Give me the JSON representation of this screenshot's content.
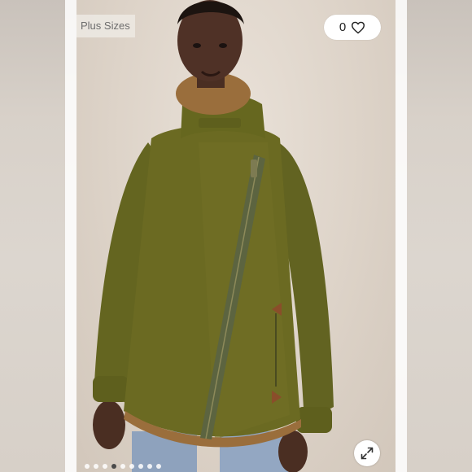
{
  "badge": {
    "label": "Plus Sizes"
  },
  "like": {
    "count": "0",
    "icon": "heart-outline-icon"
  },
  "expand": {
    "icon": "expand-arrows-icon"
  },
  "carousel": {
    "total": 9,
    "active_index": 3
  },
  "photo": {
    "subject": "olive-green-sherpa-collar-jacket"
  },
  "colors": {
    "jacket": "#6b6a22",
    "background": "#ddd3c8",
    "sherpa": "#9a6e3c"
  }
}
